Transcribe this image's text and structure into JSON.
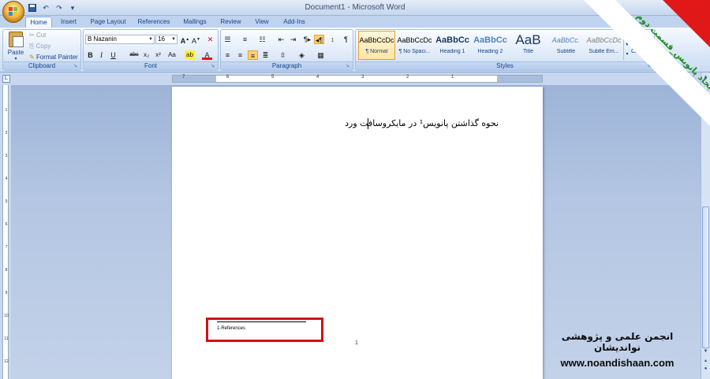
{
  "window": {
    "title": "Document1 - Microsoft Word"
  },
  "tabs": [
    {
      "label": "Home"
    },
    {
      "label": "Insert"
    },
    {
      "label": "Page Layout"
    },
    {
      "label": "References"
    },
    {
      "label": "Mailings"
    },
    {
      "label": "Review"
    },
    {
      "label": "View"
    },
    {
      "label": "Add-Ins"
    }
  ],
  "clipboard": {
    "paste": "Paste",
    "cut": "Cut",
    "copy": "Copy",
    "format_painter": "Format Painter",
    "label": "Clipboard"
  },
  "font": {
    "name": "B Nazanin",
    "size": "16",
    "label": "Font"
  },
  "paragraph": {
    "label": "Paragraph"
  },
  "styles": {
    "label": "Styles",
    "items": [
      {
        "sample": "AaBbCcDc",
        "name": "¶ Normal"
      },
      {
        "sample": "AaBbCcDc",
        "name": "¶ No Spaci..."
      },
      {
        "sample": "AaBbCc",
        "name": "Heading 1"
      },
      {
        "sample": "AaBbCc",
        "name": "Heading 2"
      },
      {
        "sample": "AaB",
        "name": "Title"
      },
      {
        "sample": "AaBbCc.",
        "name": "Subtitle"
      },
      {
        "sample": "AaBbCcDc",
        "name": "Subtle Em..."
      }
    ],
    "change": "Change Styles"
  },
  "ruler": {
    "marks": [
      "7",
      "6",
      "5",
      "4",
      "3",
      "2",
      "1"
    ]
  },
  "document": {
    "body_text": "نحوه گذاشتن پانویس¹ در مایکروسافت ورد",
    "footnote": "1-References",
    "page_number": "1"
  },
  "overlay": {
    "banner": "ایجاد پانویس_قسمت دوم",
    "org_name": "انجمن علمی و پژوهشی نواندیشان",
    "url": "www.noandishaan.com"
  },
  "colors": {
    "banner_red": "#e01818",
    "highlight_box": "#d51010",
    "banner_text": "#1c8a1c"
  }
}
